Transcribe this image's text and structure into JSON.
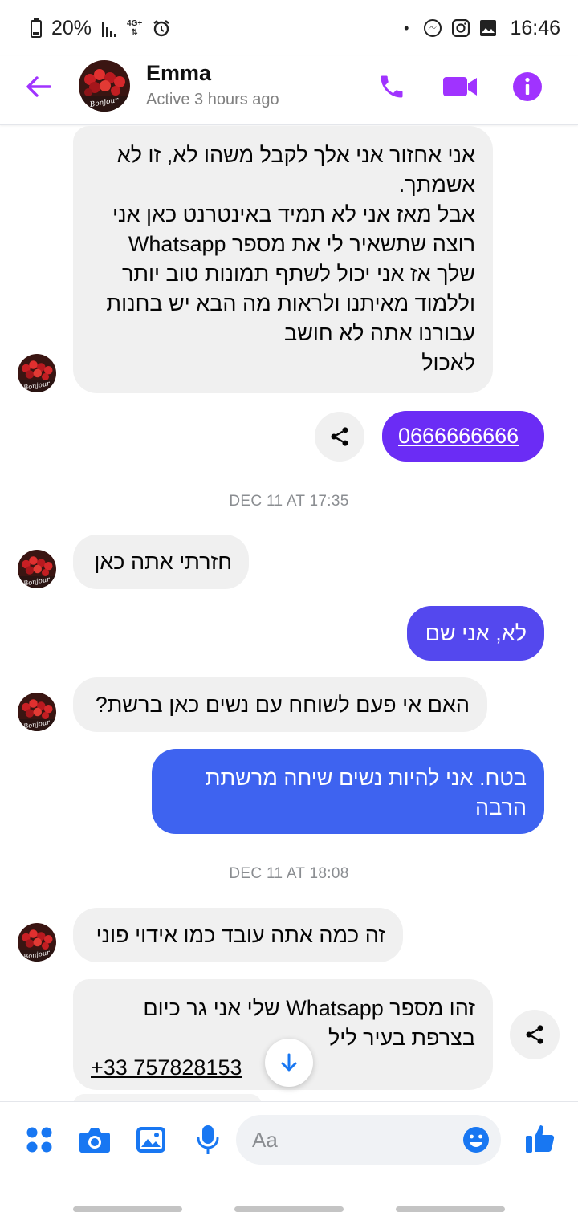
{
  "status_bar": {
    "battery": "20%",
    "network": "4G+",
    "dot": "•",
    "time": "16:46"
  },
  "header": {
    "contact_name": "Emma",
    "contact_status": "Active 3 hours ago",
    "avatar_caption": "Bonjour"
  },
  "messages": {
    "m1": {
      "lines": [
        "אני אחזור אני אלך לקבל משהו    לא, זו לא",
        "אשמתך.",
        "אבל מאז אני לא תמיד באינטרנט כאן אני",
        "רוצה שתשאיר לי את מספר Whatsapp",
        "שלך אז אני יכול לשתף תמונות טוב יותר",
        "וללמוד מאיתנו ולראות מה הבא יש בחנות",
        "עבורנו אתה לא חושב",
        "לאכול"
      ]
    },
    "m2": {
      "text": "0666666666"
    },
    "ts1": "DEC 11 AT 17:35",
    "m3": {
      "text": "חזרתי אתה כאן"
    },
    "m4": {
      "text": "לא, אני שם"
    },
    "m5": {
      "text": "האם אי פעם לשוחח עם נשים כאן ברשת?"
    },
    "m6": {
      "lines": [
        "בטח. אני להיות נשים שיחה מרשתת",
        "הרבה"
      ]
    },
    "ts2": "DEC 11 AT 18:08",
    "m7": {
      "text": "זה כמה אתה עובד כמו אידוי פוני"
    },
    "m8": {
      "lines": [
        "זהו מספר Whatsapp שלי אני גר כיום",
        "בצרפת בעיר ליל"
      ],
      "phone": "+33 757828153"
    }
  },
  "composer": {
    "placeholder": "Aa"
  },
  "colors": {
    "accent": "#a033ff",
    "messenger_blue": "#1877f2",
    "bubble_in": "#f0f0f0",
    "bubble_out_purple": "#6b2cf5",
    "bubble_out_mid": "#5448ee",
    "bubble_out_blue": "#3e63f0"
  },
  "icons": {
    "status": [
      "battery-icon",
      "signal-icon",
      "network-4g-icon",
      "alarm-icon",
      "messenger-icon",
      "instagram-icon",
      "gallery-icon"
    ],
    "header": [
      "back-arrow-icon",
      "phone-icon",
      "video-camera-icon",
      "info-icon"
    ],
    "composer": [
      "apps-grid-icon",
      "camera-icon",
      "image-icon",
      "microphone-icon",
      "emoji-icon",
      "thumbs-up-icon"
    ]
  }
}
